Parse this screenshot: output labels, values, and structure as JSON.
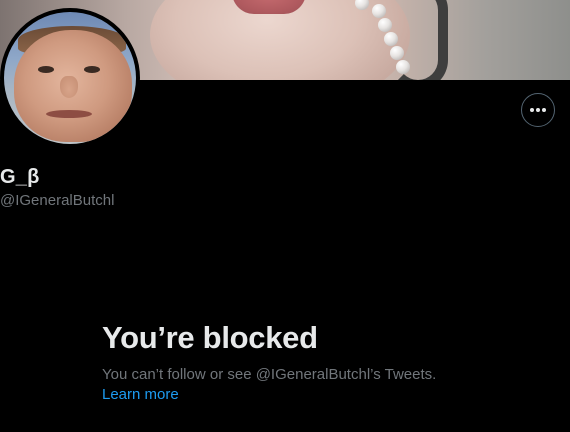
{
  "profile": {
    "display_name": "G_β",
    "handle": "@IGeneralButchl"
  },
  "more_button": {
    "icon": "more-horizontal-icon"
  },
  "blocked": {
    "title": "You’re blocked",
    "subtitle": "You can’t follow or see @IGeneralButchl’s Tweets.",
    "learn_more": "Learn more"
  },
  "colors": {
    "background": "#000000",
    "primary_text": "#e7e9ea",
    "secondary_text": "#71767b",
    "link": "#1d9bf0",
    "button_border": "#536471"
  }
}
